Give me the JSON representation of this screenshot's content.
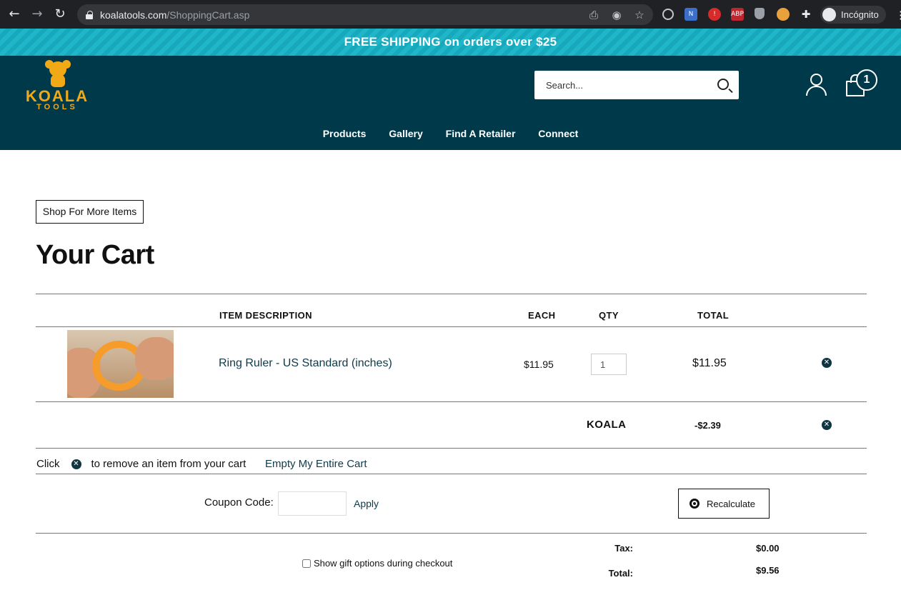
{
  "browser": {
    "url_host": "koalatools.com",
    "url_path": "/ShoppingCart.asp",
    "profile_label": "Incógnito"
  },
  "promo": {
    "text": "FREE SHIPPING on orders over $25"
  },
  "header": {
    "logo_word": "KOALA",
    "logo_sub": "TOOLS",
    "search_placeholder": "Search...",
    "cart_count": "1",
    "nav": [
      "Products",
      "Gallery",
      "Find A Retailer",
      "Connect"
    ]
  },
  "cart": {
    "shop_more_label": "Shop For More Items",
    "title": "Your Cart",
    "columns": {
      "description": "ITEM DESCRIPTION",
      "each": "EACH",
      "qty": "QTY",
      "total": "TOTAL"
    },
    "items": [
      {
        "name": "Ring Ruler - US Standard (inches)",
        "each": "$11.95",
        "qty": "1",
        "total": "$11.95"
      }
    ],
    "coupon_line": {
      "code": "KOALA",
      "amount": "-$2.39"
    },
    "help": {
      "prefix": "Click",
      "suffix": "to remove an item from your cart",
      "empty_link": "Empty My Entire Cart"
    },
    "coupon": {
      "label": "Coupon Code:",
      "value": "",
      "apply_label": "Apply"
    },
    "recalculate_label": "Recalculate",
    "gift_label": "Show gift options during checkout",
    "summary": {
      "tax_label": "Tax:",
      "tax_value": "$0.00",
      "total_label": "Total:",
      "total_value": "$9.56"
    }
  },
  "colors": {
    "header_bg": "#003a4a",
    "promo_bg": "#1fb6c9",
    "brand_orange": "#f2a916",
    "link_color": "#0e3a4a"
  }
}
